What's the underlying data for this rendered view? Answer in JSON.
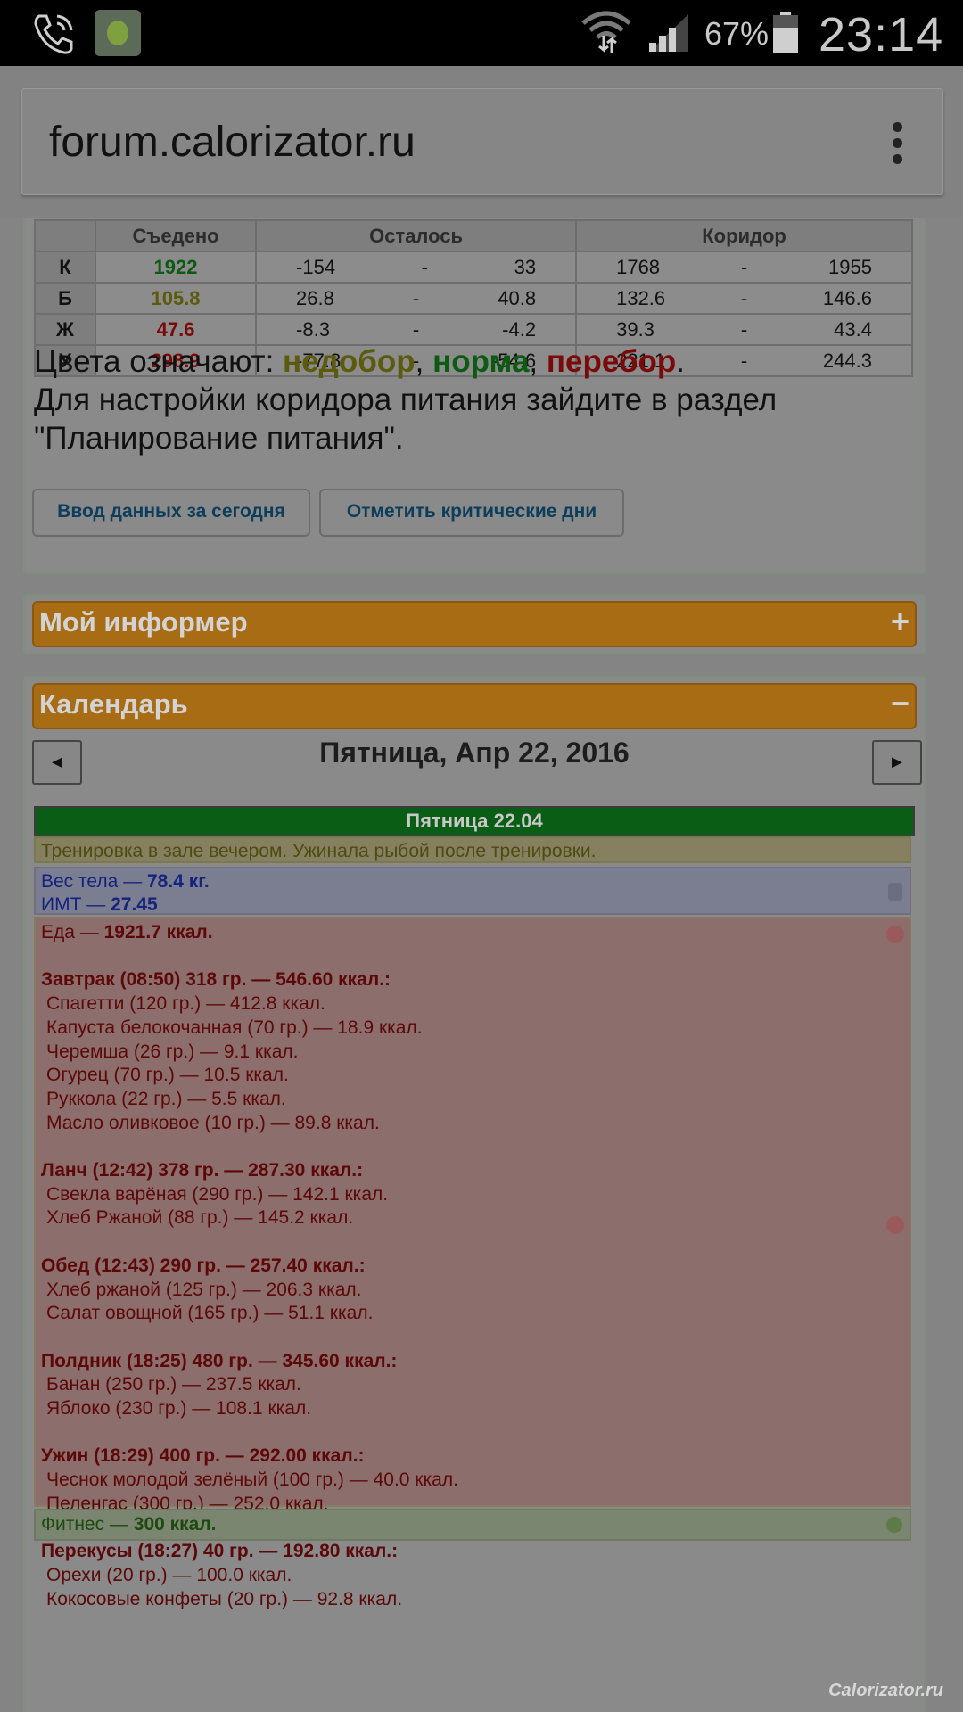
{
  "status": {
    "battery": "67%",
    "time": "23:14"
  },
  "browser": {
    "url": "forum.calorizator.ru"
  },
  "summary": {
    "headers": [
      "Съедено",
      "Осталось",
      "Коридор"
    ],
    "rows": [
      {
        "label": "К",
        "eaten": "1922",
        "eaten_color": "#0d5a12",
        "rem_from": "-154",
        "rem_to": "33",
        "cor_from": "1768",
        "cor_to": "1955"
      },
      {
        "label": "Б",
        "eaten": "105.8",
        "eaten_color": "#5b5a0d",
        "rem_from": "26.8",
        "rem_to": "40.8",
        "cor_from": "132.6",
        "cor_to": "146.6"
      },
      {
        "label": "Ж",
        "eaten": "47.6",
        "eaten_color": "#7a0a0a",
        "rem_from": "-8.3",
        "rem_to": "-4.2",
        "cor_from": "39.3",
        "cor_to": "43.4"
      },
      {
        "label": "У",
        "eaten": "298.9",
        "eaten_color": "#7a0a0a",
        "rem_from": "-77.8",
        "rem_to": "-54.6",
        "cor_from": "221.1",
        "cor_to": "244.3"
      }
    ],
    "dash": "-",
    "legend_prefix": "Цвета означают: ",
    "legend_under": "недобор",
    "legend_norm": "норма",
    "legend_over": "перебор",
    "legend_sep": ", ",
    "legend_end": ".",
    "legend_note": "Для настройки коридора питания зайдите в раздел \"Планирование питания\".",
    "btn_today": "Ввод данных за сегодня",
    "btn_critical": "Отметить критические дни"
  },
  "informer": {
    "title": "Мой информер",
    "toggle": "+"
  },
  "calendar": {
    "title": "Календарь",
    "toggle": "−",
    "prev": "◄",
    "next": "►",
    "date": "Пятница, Апр 22, 2016",
    "day_header": "Пятница 22.04",
    "note": "Тренировка в зале вечером. Ужинала рыбой после тренировки.",
    "weight_label": "Вес тела — ",
    "weight_value": "78.4 кг.",
    "bmi_label": "ИМТ — ",
    "bmi_value": "27.45",
    "food_label": "Еда — ",
    "food_value": "1921.7 ккал.",
    "meals": [
      {
        "title": "Завтрак (08:50) 318 гр. — 546.60 ккал.:",
        "items": [
          "Спагетти (120 гр.) — 412.8 ккал.",
          "Капуста белокочанная (70 гр.) — 18.9 ккал.",
          "Черемша (26 гр.) — 9.1 ккал.",
          "Огурец (70 гр.) — 10.5 ккал.",
          "Руккола (22 гр.) — 5.5 ккал.",
          "Масло оливковое (10 гр.) — 89.8 ккал."
        ]
      },
      {
        "title": "Ланч (12:42) 378 гр. — 287.30 ккал.:",
        "items": [
          "Свекла варёная (290 гр.) — 142.1 ккал.",
          "Хлеб Ржаной (88 гр.) — 145.2 ккал."
        ]
      },
      {
        "title": "Обед (12:43) 290 гр. — 257.40 ккал.:",
        "items": [
          "Хлеб ржаной (125 гр.) — 206.3 ккал.",
          "Салат овощной (165 гр.) — 51.1 ккал."
        ]
      },
      {
        "title": "Полдник (18:25) 480 гр. — 345.60 ккал.:",
        "items": [
          "Банан (250 гр.) — 237.5 ккал.",
          "Яблоко (230 гр.) — 108.1 ккал."
        ]
      },
      {
        "title": "Ужин (18:29) 400 гр. — 292.00 ккал.:",
        "items": [
          "Чеснок молодой зелёный (100 гр.) — 40.0 ккал.",
          "Пеленгас (300 гр.) — 252.0 ккал."
        ]
      },
      {
        "title": "Перекусы (18:27) 40 гр. — 192.80 ккал.:",
        "items": [
          "Орехи (20 гр.) — 100.0 ккал.",
          "Кокосовые конфеты (20 гр.) — 92.8 ккал."
        ]
      }
    ],
    "fitness_label": "Фитнес — ",
    "fitness_value": "300 ккал."
  },
  "watermark": "Calorizator.ru"
}
